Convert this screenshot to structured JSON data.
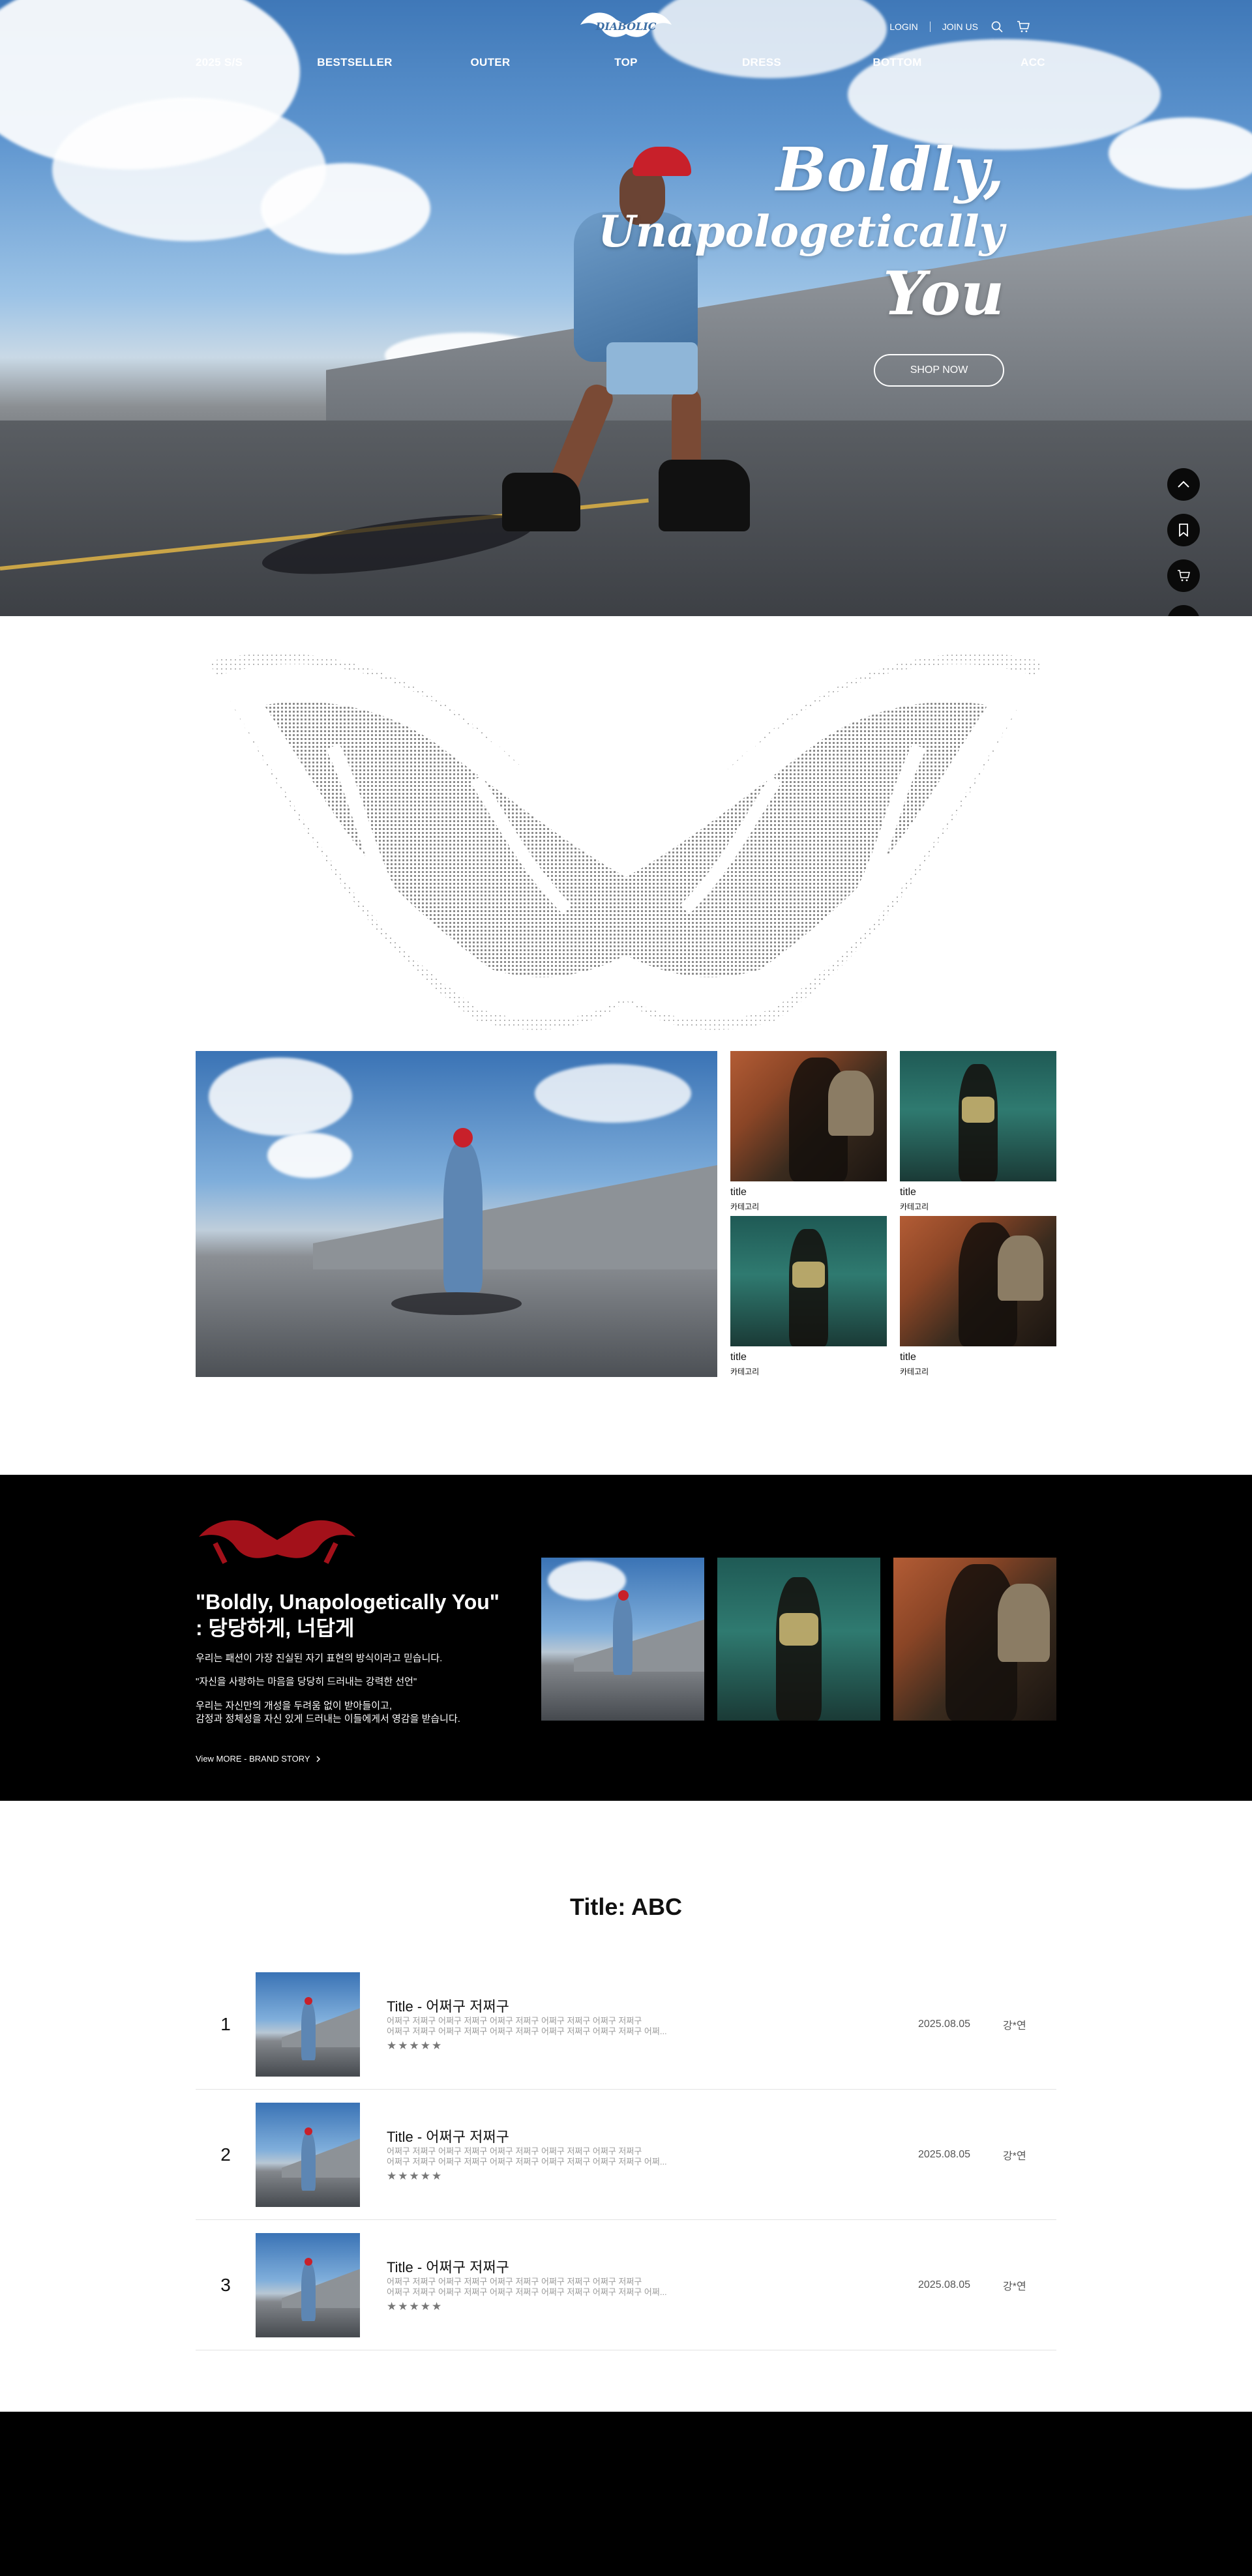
{
  "header": {
    "logo_text": "DIABOLIC",
    "util": {
      "login": "LOGIN",
      "join": "JOIN US"
    },
    "nav": [
      "2025 S/S",
      "BESTSELLER",
      "OUTER",
      "TOP",
      "DRESS",
      "BOTTOM",
      "ACC"
    ]
  },
  "hero": {
    "title_line1": "Boldly,",
    "title_line2": "Unapologetically",
    "title_line3": "You",
    "cta": "SHOP NOW"
  },
  "gallery": {
    "items": [
      {
        "title": "title",
        "category": "카테고리"
      },
      {
        "title": "title",
        "category": "카테고리"
      },
      {
        "title": "title",
        "category": "카테고리"
      },
      {
        "title": "title",
        "category": "카테고리"
      }
    ]
  },
  "story": {
    "heading_line1": "\"Boldly, Unapologetically You\"",
    "heading_line2": " : 당당하게, 너답게",
    "p1": "우리는 패션이 가장 진실된 자기 표현의 방식이라고 믿습니다.",
    "p2": "\"자신을 사랑하는 마음을 당당히 드러내는 강력한 선언\"",
    "p3_line1": "우리는 자신만의 개성을 두려움 없이 받아들이고,",
    "p3_line2": "감정과 정체성을 자신 있게 드러내는 이들에게서 영감을 받습니다.",
    "link": "View MORE - BRAND STORY"
  },
  "ranking": {
    "title": "Title: ABC",
    "rows": [
      {
        "rank": "1",
        "name": "Title - 어쩌구 저쩌구",
        "desc1": "어쩌구 저쩌구 어쩌구 저쩌구 어쩌구 저쩌구 어쩌구 저쩌구 어쩌구 저쩌구",
        "desc2": "어쩌구 저쩌구 어쩌구 저쩌구 어쩌구 저쩌구 어쩌구 저쩌구 어쩌구 저쩌구 어쩌...",
        "stars": "★★★★★",
        "date": "2025.08.05",
        "user": "강*연"
      },
      {
        "rank": "2",
        "name": "Title - 어쩌구 저쩌구",
        "desc1": "어쩌구 저쩌구 어쩌구 저쩌구 어쩌구 저쩌구 어쩌구 저쩌구 어쩌구 저쩌구",
        "desc2": "어쩌구 저쩌구 어쩌구 저쩌구 어쩌구 저쩌구 어쩌구 저쩌구 어쩌구 저쩌구 어쩌...",
        "stars": "★★★★★",
        "date": "2025.08.05",
        "user": "강*연"
      },
      {
        "rank": "3",
        "name": "Title - 어쩌구 저쩌구",
        "desc1": "어쩌구 저쩌구 어쩌구 저쩌구 어쩌구 저쩌구 어쩌구 저쩌구 어쩌구 저쩌구",
        "desc2": "어쩌구 저쩌구 어쩌구 저쩌구 어쩌구 저쩌구 어쩌구 저쩌구 어쩌구 저쩌구 어쩌...",
        "stars": "★★★★★",
        "date": "2025.08.05",
        "user": "강*연"
      }
    ]
  },
  "colors": {
    "logo_red": "#a3111a",
    "black": "#000000",
    "white": "#ffffff"
  },
  "icons": [
    "search-icon",
    "cart-icon",
    "chevron-up-icon",
    "bookmark-icon",
    "chevron-down-icon",
    "chevron-right-icon"
  ]
}
